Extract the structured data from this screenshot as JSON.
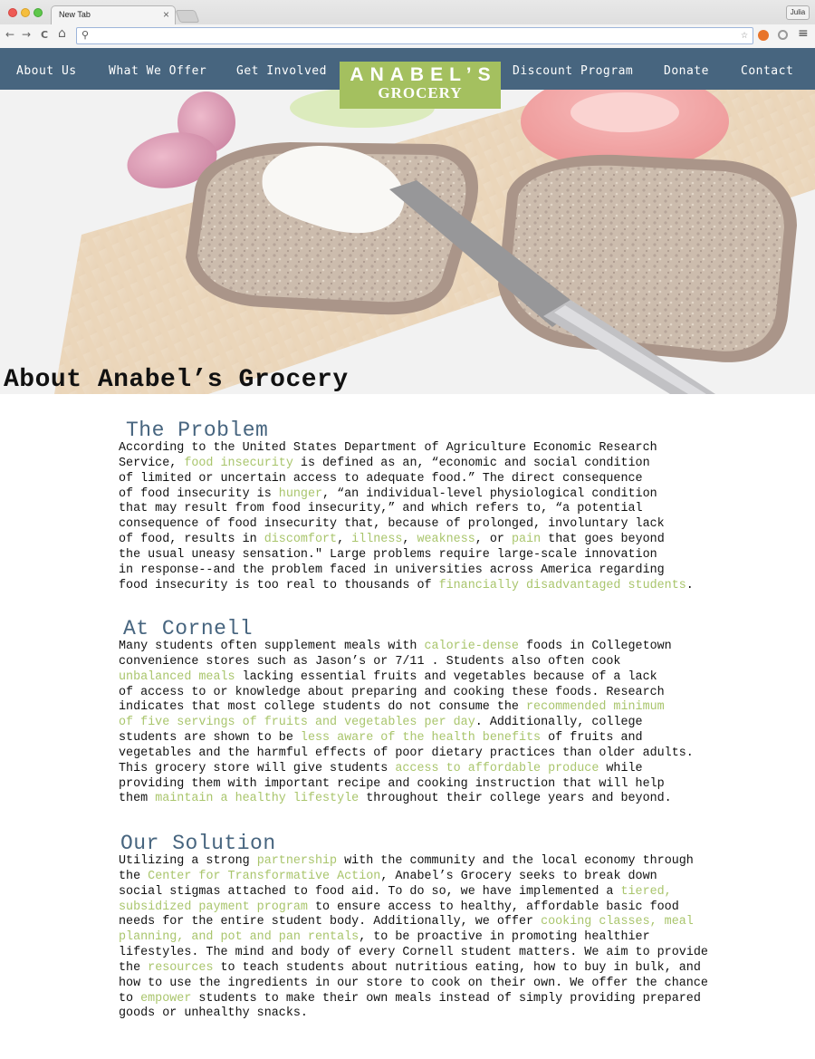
{
  "browser": {
    "tab_title": "New Tab",
    "tab_close": "×",
    "profile": "Julia",
    "address_value": "",
    "back_glyph": "←",
    "forward_glyph": "→",
    "reload_glyph": "C",
    "home_glyph": "⌂",
    "search_glyph": "⚲",
    "star_glyph": "☆",
    "menu_glyph": "≡"
  },
  "nav": {
    "items": [
      {
        "label": "About Us"
      },
      {
        "label": "What We Offer"
      },
      {
        "label": "Get Involved"
      },
      {
        "label": "Discount Program"
      },
      {
        "label": "Donate"
      },
      {
        "label": "Contact"
      }
    ],
    "logo_top": "ANABEL’S",
    "logo_bottom": "GROCERY"
  },
  "hero": {
    "title": "About Anabel’s Grocery"
  },
  "sections": [
    {
      "heading": "The Problem",
      "lines": [
        [
          {
            "t": "According to the United States Department of Agriculture Economic Research"
          }
        ],
        [
          {
            "t": "Service, "
          },
          {
            "t": "food insecurity",
            "hl": true
          },
          {
            "t": " is defined as an, “economic and social condition"
          }
        ],
        [
          {
            "t": "of limited or uncertain access to adequate food.” The direct consequence"
          }
        ],
        [
          {
            "t": "of food insecurity is "
          },
          {
            "t": "hunger",
            "hl": true
          },
          {
            "t": ", “an individual-level physiological condition"
          }
        ],
        [
          {
            "t": "that may result from food insecurity,” and which refers to, “a potential"
          }
        ],
        [
          {
            "t": "consequence of food insecurity that, because of prolonged, involuntary lack"
          }
        ],
        [
          {
            "t": "of food, results in "
          },
          {
            "t": "discomfort",
            "hl": true
          },
          {
            "t": ", "
          },
          {
            "t": "illness",
            "hl": true
          },
          {
            "t": ", "
          },
          {
            "t": "weakness",
            "hl": true
          },
          {
            "t": ", or "
          },
          {
            "t": "pain",
            "hl": true
          },
          {
            "t": " that goes beyond"
          }
        ],
        [
          {
            "t": "the usual uneasy sensation.\" Large problems require large-scale innovation"
          }
        ],
        [
          {
            "t": "in response--and the problem faced in universities across America regarding"
          }
        ],
        [
          {
            "t": "food insecurity is too real to thousands of "
          },
          {
            "t": "financially disadvantaged students",
            "hl": true
          },
          {
            "t": "."
          }
        ]
      ]
    },
    {
      "heading": "At Cornell",
      "lines": [
        [
          {
            "t": "Many students often supplement meals with "
          },
          {
            "t": "calorie-dense",
            "hl": true
          },
          {
            "t": " foods in Collegetown"
          }
        ],
        [
          {
            "t": "convenience stores such as Jason’s or 7/11 . Students also often cook"
          }
        ],
        [
          {
            "t": "unbalanced meals",
            "hl": true
          },
          {
            "t": " lacking essential fruits and vegetables because of a lack"
          }
        ],
        [
          {
            "t": "of access to or knowledge about preparing and cooking these foods. Research"
          }
        ],
        [
          {
            "t": "indicates that most college students do not consume the "
          },
          {
            "t": "recommended minimum",
            "hl": true
          }
        ],
        [
          {
            "t": "of five servings of fruits and vegetables per day",
            "hl": true
          },
          {
            "t": ". Additionally, college"
          }
        ],
        [
          {
            "t": "students are shown to be "
          },
          {
            "t": "less aware of the health benefits",
            "hl": true
          },
          {
            "t": " of fruits and"
          }
        ],
        [
          {
            "t": "vegetables and the harmful effects of poor dietary practices than older adults."
          }
        ],
        [
          {
            "t": "This grocery store will give students "
          },
          {
            "t": "access to affordable produce",
            "hl": true
          },
          {
            "t": " while"
          }
        ],
        [
          {
            "t": "providing them with important recipe and cooking instruction that will help"
          }
        ],
        [
          {
            "t": "them "
          },
          {
            "t": "maintain a healthy lifestyle",
            "hl": true
          },
          {
            "t": " throughout their college years and beyond."
          }
        ]
      ]
    },
    {
      "heading": "Our Solution",
      "lines": [
        [
          {
            "t": "Utilizing a strong "
          },
          {
            "t": "partnership",
            "hl": true
          },
          {
            "t": " with the community and the local economy through"
          }
        ],
        [
          {
            "t": "the "
          },
          {
            "t": "Center for Transformative Action",
            "hl": true
          },
          {
            "t": ", Anabel’s Grocery seeks to break down"
          }
        ],
        [
          {
            "t": "social stigmas attached to food aid. To do so, we have implemented a "
          },
          {
            "t": "tiered,",
            "hl": true
          }
        ],
        [
          {
            "t": "subsidized payment program",
            "hl": true
          },
          {
            "t": " to ensure access to healthy, affordable basic food"
          }
        ],
        [
          {
            "t": "needs for the entire student body. Additionally, we offer "
          },
          {
            "t": "cooking classes, meal",
            "hl": true
          }
        ],
        [
          {
            "t": "planning, and pot and pan rentals",
            "hl": true
          },
          {
            "t": ", to be proactive in promoting healthier"
          }
        ],
        [
          {
            "t": "lifestyles. The mind and body of every Cornell student matters. We aim to provide"
          }
        ],
        [
          {
            "t": "the "
          },
          {
            "t": "resources",
            "hl": true
          },
          {
            "t": " to teach students about nutritious eating, how to buy in bulk, and"
          }
        ],
        [
          {
            "t": "how to use the ingredients in our store to cook on their own. We offer the chance"
          }
        ],
        [
          {
            "t": "to "
          },
          {
            "t": "empower",
            "hl": true
          },
          {
            "t": " students to make their own meals instead of simply providing prepared"
          }
        ],
        [
          {
            "t": "goods or unhealthy snacks."
          }
        ]
      ]
    }
  ],
  "colors": {
    "nav_bg": "#47657f",
    "logo_bg": "#a4c05f",
    "heading": "#47657f",
    "highlight": "#a9c56c"
  }
}
